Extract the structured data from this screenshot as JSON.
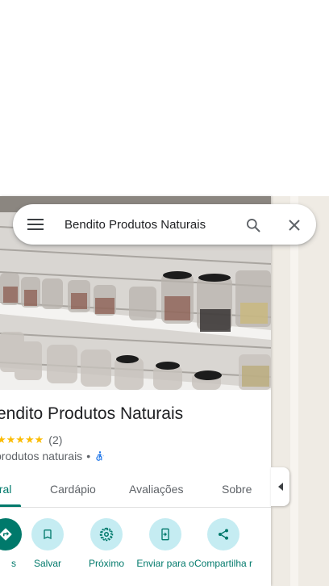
{
  "search": {
    "query": "Bendito Produtos Naturais",
    "menu_icon": "hamburger-menu-icon",
    "search_icon": "magnifier-icon",
    "close_icon": "close-x-icon"
  },
  "place": {
    "name": "Bendito Produtos Naturais",
    "rating_stars": "★★★★★",
    "rating_count": "(2)",
    "category": "produtos naturais",
    "separator": "•",
    "accessibility_icon": "wheelchair-icon"
  },
  "tabs": [
    {
      "label": "Visão geral",
      "visible_label": "eral",
      "active": true
    },
    {
      "label": "Cardápio",
      "active": false
    },
    {
      "label": "Avaliações",
      "active": false
    },
    {
      "label": "Sobre",
      "active": false
    }
  ],
  "actions": [
    {
      "label": "s",
      "icon": "directions-icon"
    },
    {
      "label": "Salvar",
      "icon": "bookmark-icon"
    },
    {
      "label": "Próximo",
      "icon": "nearby-icon"
    },
    {
      "label": "Enviar para o",
      "icon": "send-to-phone-icon"
    },
    {
      "label": "Compartilha r",
      "icon": "share-icon"
    }
  ],
  "colors": {
    "accent": "#00796b",
    "action_bg": "#c5ecf2",
    "star": "#fbbc04",
    "map_bg": "#efebe4"
  }
}
